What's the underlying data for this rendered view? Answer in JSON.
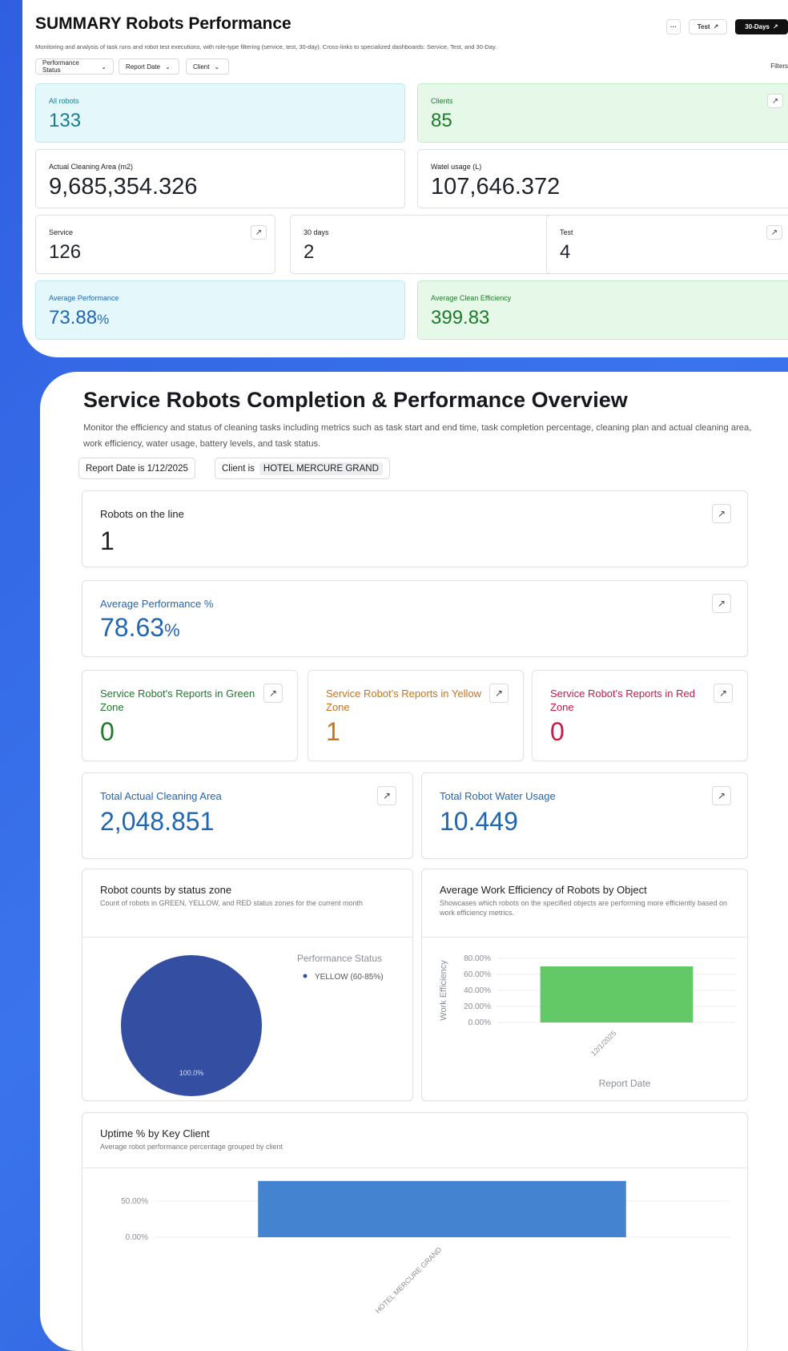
{
  "summary": {
    "title": "SUMMARY Robots Performance",
    "description": "Monitoring and analysis of task runs and robot test executions, with role-type filtering (service, test, 30-day). Cross-links to specialized dashboards: Service, Test, and 30-Day.",
    "header_buttons": {
      "more": "···",
      "test": "Test",
      "thirty_days": "30-Days"
    },
    "filters": [
      "Performance Status",
      "Report Date",
      "Client"
    ],
    "filters_label": "Filters",
    "cards": {
      "all_robots": {
        "label": "All robots",
        "value": "133"
      },
      "clients": {
        "label": "Clients",
        "value": "85"
      },
      "cleaning_area": {
        "label": "Actual Cleaning Area (m2)",
        "value": "9,685,354.326"
      },
      "water_usage": {
        "label": "Watel usage (L)",
        "value": "107,646.372"
      },
      "service": {
        "label": "Service",
        "value": "126"
      },
      "thirty_days": {
        "label": "30 days",
        "value": "2"
      },
      "test": {
        "label": "Test",
        "value": "4"
      },
      "avg_performance": {
        "label": "Average Performance",
        "value": "73.88",
        "unit": "%"
      },
      "avg_clean_efficiency": {
        "label": "Average Clean Efficiency",
        "value": "399.83"
      }
    }
  },
  "service": {
    "title": "Service Robots Completion & Performance Overview",
    "description": "Monitor the efficiency and status of cleaning tasks including metrics such as task start and end time, task completion percentage, cleaning plan and actual cleaning area, work efficiency, water usage, battery levels, and task status.",
    "chips": {
      "report_date": "Report Date is 1/12/2025",
      "client_prefix": "Client is",
      "client_value": "HOTEL MERCURE GRAND"
    },
    "cards": {
      "robots_on_line": {
        "label": "Robots on the line",
        "value": "1"
      },
      "avg_performance": {
        "label": "Average Performance %",
        "value": "78.63",
        "unit": "%"
      },
      "green_zone": {
        "label": "Service Robot's Reports in Green Zone",
        "value": "0"
      },
      "yellow_zone": {
        "label": "Service Robot's Reports in Yellow Zone",
        "value": "1"
      },
      "red_zone": {
        "label": "Service Robot's Reports in Red Zone",
        "value": "0"
      },
      "total_area": {
        "label": "Total Actual Cleaning Area",
        "value": "2,048.851"
      },
      "total_water": {
        "label": "Total Robot Water Usage",
        "value": "10.449"
      }
    },
    "charts": {
      "status_zone": {
        "title": "Robot counts by status zone",
        "subtitle": "Count of robots in GREEN, YELLOW, and RED status zones for the current month",
        "legend_title": "Performance Status"
      },
      "work_efficiency": {
        "title": "Average Work Efficiency of Robots by Object",
        "subtitle": "Showcases which robots on the specified objects are performing more efficiently based on work efficiency metrics."
      },
      "uptime": {
        "title": "Uptime % by Key Client",
        "subtitle": "Average robot performance percentage grouped by client"
      }
    }
  },
  "colors": {
    "pie_yellow_zone": "#344ea1",
    "efficiency_bar": "#63c866",
    "uptime_bar": "#4483cf",
    "cyan_card": "#e4f8fb",
    "green_card": "#e6f9e8",
    "blue_text": "#2166b0",
    "green_text": "#1f7a2b",
    "orange_text": "#c9741a",
    "red_text": "#c8184a",
    "background": "#2f5fe0"
  },
  "chart_data": [
    {
      "type": "pie",
      "legend_title": "Performance Status",
      "labels": [
        "YELLOW (60-85%)"
      ],
      "values": [
        100.0
      ],
      "value_labels": [
        "100.0%"
      ]
    },
    {
      "type": "bar",
      "categories": [
        "12/1/2025"
      ],
      "values": [
        0.7
      ],
      "xlabel": "Report Date",
      "ylabel": "Work Efficiency",
      "ytick_labels": [
        "0.00%",
        "20.00%",
        "40.00%",
        "60.00%",
        "80.00%"
      ],
      "ylim": [
        0,
        0.8
      ]
    },
    {
      "type": "bar",
      "categories": [
        "HOTEL MERCURE GRAND"
      ],
      "values": [
        0.78
      ],
      "ytick_labels": [
        "0.00%",
        "50.00%"
      ],
      "ylim": [
        0,
        0.8
      ]
    }
  ]
}
